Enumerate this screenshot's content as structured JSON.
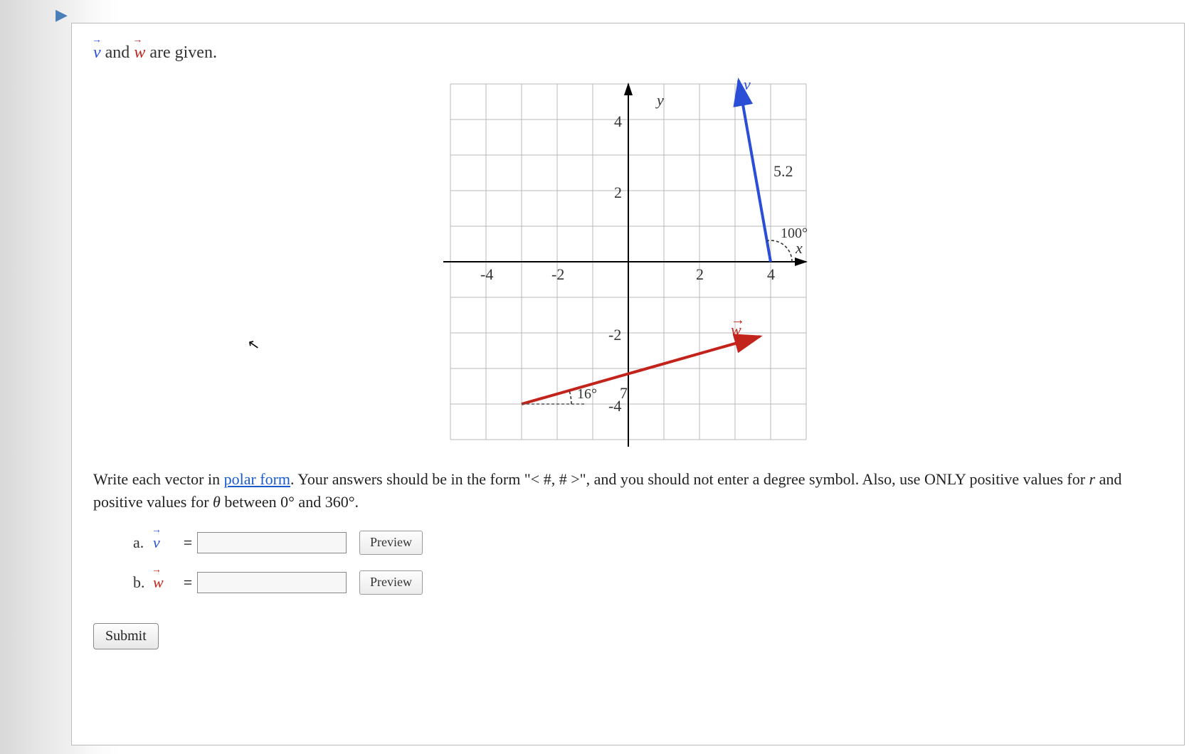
{
  "intro": {
    "v_symbol": "v",
    "w_symbol": "w",
    "text_after": " are given.",
    "text_mid": " and "
  },
  "chart_data": {
    "type": "vector-plot",
    "xlim": [
      -5,
      5
    ],
    "ylim": [
      -5,
      5
    ],
    "x_ticks": [
      -4,
      -2,
      2,
      4
    ],
    "y_ticks": [
      -4,
      -2,
      2,
      4
    ],
    "xlabel": "x",
    "ylabel": "y",
    "grid": true,
    "vectors": [
      {
        "name": "v",
        "color": "#2a4fd6",
        "start": [
          4,
          0
        ],
        "end": [
          3.1,
          5.1
        ],
        "magnitude_label": "5.2",
        "angle_label": "100°",
        "angle_deg": 100
      },
      {
        "name": "w",
        "color": "#c2231b",
        "start": [
          -3,
          -4
        ],
        "end": [
          3.7,
          -2.1
        ],
        "magnitude_label": "7",
        "angle_label": "16°",
        "angle_deg": 16
      }
    ]
  },
  "instructions": {
    "prefix": "Write each vector in ",
    "link_text": "polar form",
    "mid1": ". Your answers should be in the form \"< #, # >\", and you should not enter a degree symbol. Also, use ONLY positive values for ",
    "r_var": "r",
    "mid2": " and positive values for ",
    "theta_var": "θ",
    "suffix": " between 0° and 360°."
  },
  "answers": {
    "a": {
      "part": "a.",
      "vec": "v",
      "eq": "=",
      "value": "",
      "preview": "Preview"
    },
    "b": {
      "part": "b.",
      "vec": "w",
      "eq": "=",
      "value": "",
      "preview": "Preview"
    }
  },
  "submit_label": "Submit"
}
